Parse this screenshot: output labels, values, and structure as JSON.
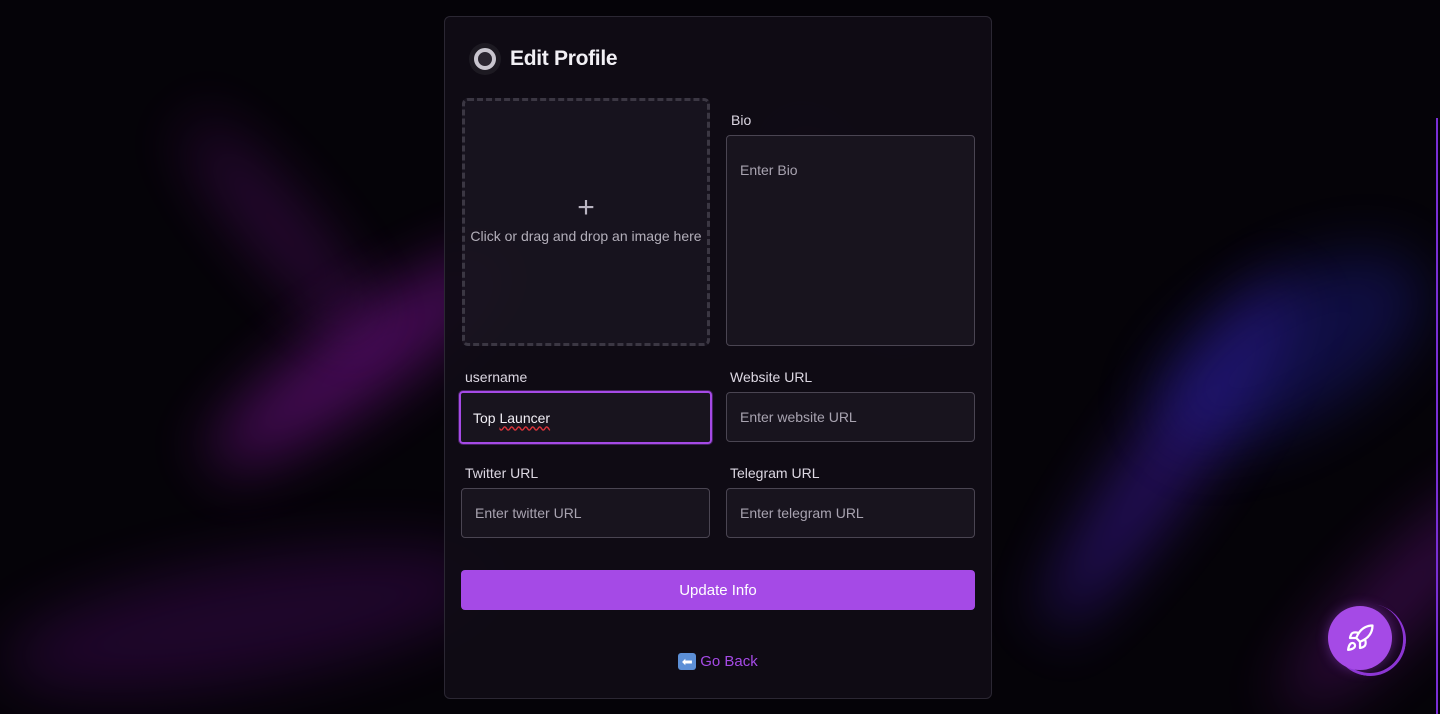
{
  "header": {
    "title": "Edit Profile",
    "logo_icon": "ring-logo-icon"
  },
  "dropzone": {
    "icon": "plus-icon",
    "plus_glyph": "+",
    "text": "Click or drag and drop an image here"
  },
  "bio": {
    "label": "Bio",
    "placeholder": "Enter Bio"
  },
  "username": {
    "label": "username",
    "value_first": "Top",
    "value_second": "Launcer"
  },
  "website": {
    "label": "Website URL",
    "placeholder": "Enter website URL"
  },
  "twitter": {
    "label": "Twitter URL",
    "placeholder": "Enter twitter URL"
  },
  "telegram": {
    "label": "Telegram URL",
    "placeholder": "Enter telegram URL"
  },
  "actions": {
    "update_label": "Update Info",
    "go_back_label": "Go Back",
    "go_back_icon": "left-arrow-icon",
    "go_back_glyph": "⬅"
  },
  "fab": {
    "icon": "rocket-icon"
  },
  "colors": {
    "accent": "#a54ae6",
    "background": "#050308",
    "card": "#100c16"
  }
}
